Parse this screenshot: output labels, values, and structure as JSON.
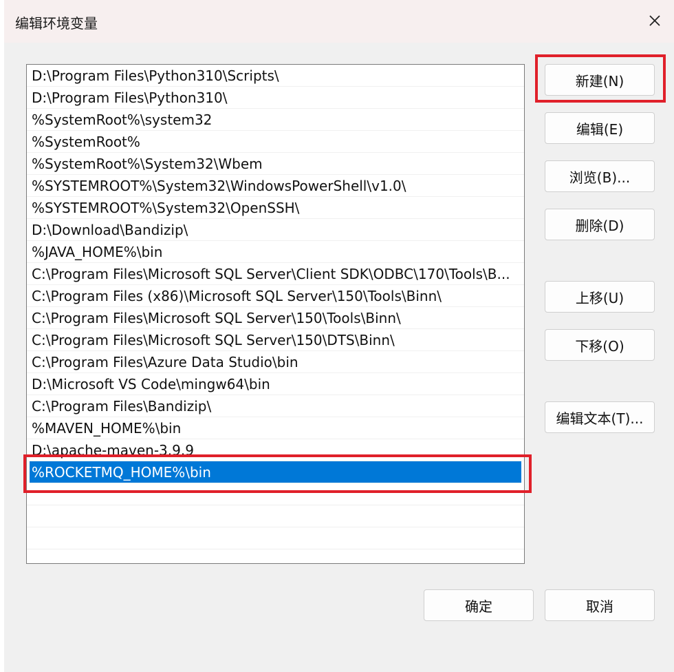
{
  "window": {
    "title": "编辑环境变量"
  },
  "path_list": {
    "items": [
      "D:\\Program Files\\Python310\\Scripts\\",
      "D:\\Program Files\\Python310\\",
      "%SystemRoot%\\system32",
      "%SystemRoot%",
      "%SystemRoot%\\System32\\Wbem",
      "%SYSTEMROOT%\\System32\\WindowsPowerShell\\v1.0\\",
      "%SYSTEMROOT%\\System32\\OpenSSH\\",
      "D:\\Download\\Bandizip\\",
      "%JAVA_HOME%\\bin",
      "C:\\Program Files\\Microsoft SQL Server\\Client SDK\\ODBC\\170\\Tools\\B...",
      "C:\\Program Files (x86)\\Microsoft SQL Server\\150\\Tools\\Binn\\",
      "C:\\Program Files\\Microsoft SQL Server\\150\\Tools\\Binn\\",
      "C:\\Program Files\\Microsoft SQL Server\\150\\DTS\\Binn\\",
      "C:\\Program Files\\Azure Data Studio\\bin",
      "D:\\Microsoft VS Code\\mingw64\\bin",
      "C:\\Program Files\\Bandizip\\",
      "%MAVEN_HOME%\\bin",
      "D:\\apache-maven-3.9.9",
      "%ROCKETMQ_HOME%\\bin"
    ],
    "selected_index": 18
  },
  "buttons": {
    "new": "新建(N)",
    "edit": "编辑(E)",
    "browse": "浏览(B)...",
    "delete": "删除(D)",
    "move_up": "上移(U)",
    "move_down": "下移(O)",
    "edit_text": "编辑文本(T)...",
    "ok": "确定",
    "cancel": "取消"
  },
  "colors": {
    "selection": "#0078d7",
    "highlight_box": "#e0202a"
  }
}
